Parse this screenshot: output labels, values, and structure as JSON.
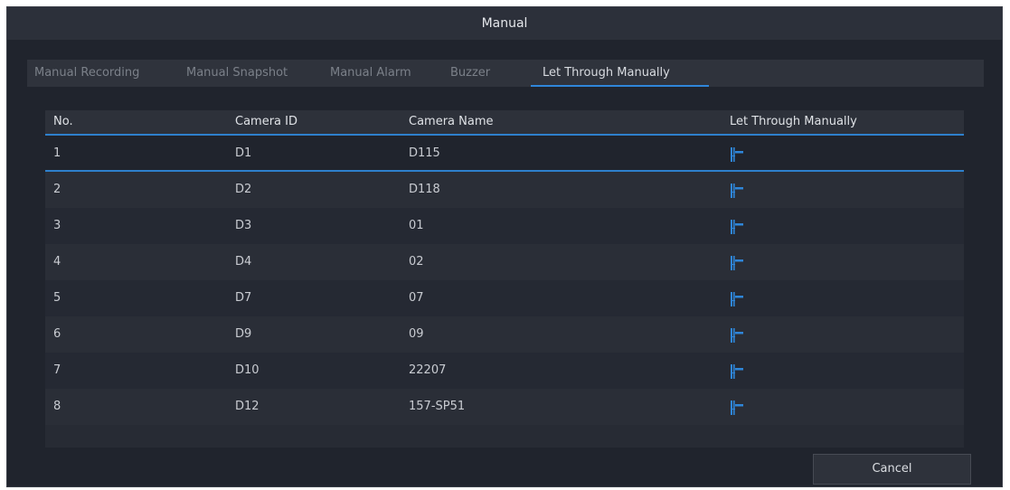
{
  "dialog": {
    "title": "Manual"
  },
  "tabs": [
    {
      "label": "Manual Recording"
    },
    {
      "label": "Manual Snapshot"
    },
    {
      "label": "Manual Alarm"
    },
    {
      "label": "Buzzer"
    },
    {
      "label": "Let Through Manually"
    }
  ],
  "active_tab": "Let Through Manually",
  "table": {
    "columns": [
      "No.",
      "Camera ID",
      "Camera Name",
      "Let Through Manually"
    ],
    "rows": [
      {
        "no": "1",
        "camera_id": "D1",
        "camera_name": "D115"
      },
      {
        "no": "2",
        "camera_id": "D2",
        "camera_name": "D118"
      },
      {
        "no": "3",
        "camera_id": "D3",
        "camera_name": "01"
      },
      {
        "no": "4",
        "camera_id": "D4",
        "camera_name": "02"
      },
      {
        "no": "5",
        "camera_id": "D7",
        "camera_name": "07"
      },
      {
        "no": "6",
        "camera_id": "D9",
        "camera_name": "09"
      },
      {
        "no": "7",
        "camera_id": "D10",
        "camera_name": "22207"
      },
      {
        "no": "8",
        "camera_id": "D12",
        "camera_name": "157-SP51"
      }
    ],
    "row_icon": "barrier-gate-icon"
  },
  "footer": {
    "cancel_label": "Cancel"
  },
  "colors": {
    "accent": "#2e80cc",
    "icon": "#2f86d9",
    "background": "#20242d"
  }
}
